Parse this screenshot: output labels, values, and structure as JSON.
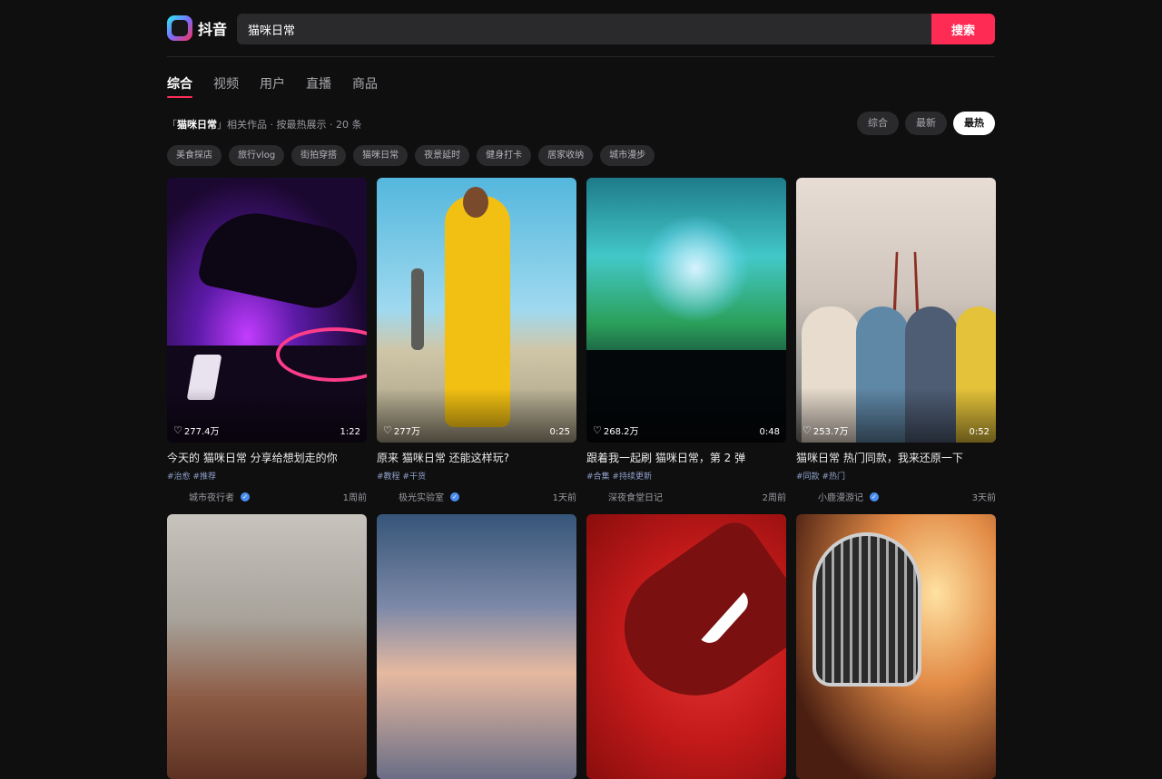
{
  "app": {
    "name": "抖音"
  },
  "search": {
    "value": "猫咪日常",
    "button_label": "搜索"
  },
  "tabs": [
    {
      "label": "综合",
      "active": true
    },
    {
      "label": "视频",
      "active": false
    },
    {
      "label": "用户",
      "active": false
    },
    {
      "label": "直播",
      "active": false
    },
    {
      "label": "商品",
      "active": false
    }
  ],
  "summary": {
    "open_quote": "「",
    "keyword": "猫咪日常",
    "text": "」相关作品 · 按最热展示 · 20 条"
  },
  "sort_options": [
    {
      "label": "综合",
      "active": false
    },
    {
      "label": "最新",
      "active": false
    },
    {
      "label": "最热",
      "active": true
    }
  ],
  "chips": [
    "美食探店",
    "旅行vlog",
    "街拍穿搭",
    "猫咪日常",
    "夜景延时",
    "健身打卡",
    "居家收纳",
    "城市漫步"
  ],
  "videos": [
    {
      "likes": "277.4万",
      "duration": "1:22",
      "title": "今天的 猫咪日常 分享给想划走的你",
      "tags": "#治愈 #推荐",
      "author": "城市夜行者",
      "verified": true,
      "ago": "1周前"
    },
    {
      "likes": "277万",
      "duration": "0:25",
      "title": "原来 猫咪日常 还能这样玩?",
      "tags": "#教程 #干货",
      "author": "极光实验室",
      "verified": true,
      "ago": "1天前"
    },
    {
      "likes": "268.2万",
      "duration": "0:48",
      "title": "跟着我一起刷 猫咪日常，第 2 弹",
      "tags": "#合集 #持续更新",
      "author": "深夜食堂日记",
      "verified": false,
      "ago": "2周前"
    },
    {
      "likes": "253.7万",
      "duration": "0:52",
      "title": "猫咪日常 热门同款，我来还原一下",
      "tags": "#同款 #热门",
      "author": "小鹿漫游记",
      "verified": true,
      "ago": "3天前"
    }
  ],
  "icons": {
    "heart": "♡",
    "verify": "✓"
  },
  "colors": {
    "accent": "#fe2c55",
    "background": "#0f0f10",
    "verify": "#4a8df0"
  }
}
